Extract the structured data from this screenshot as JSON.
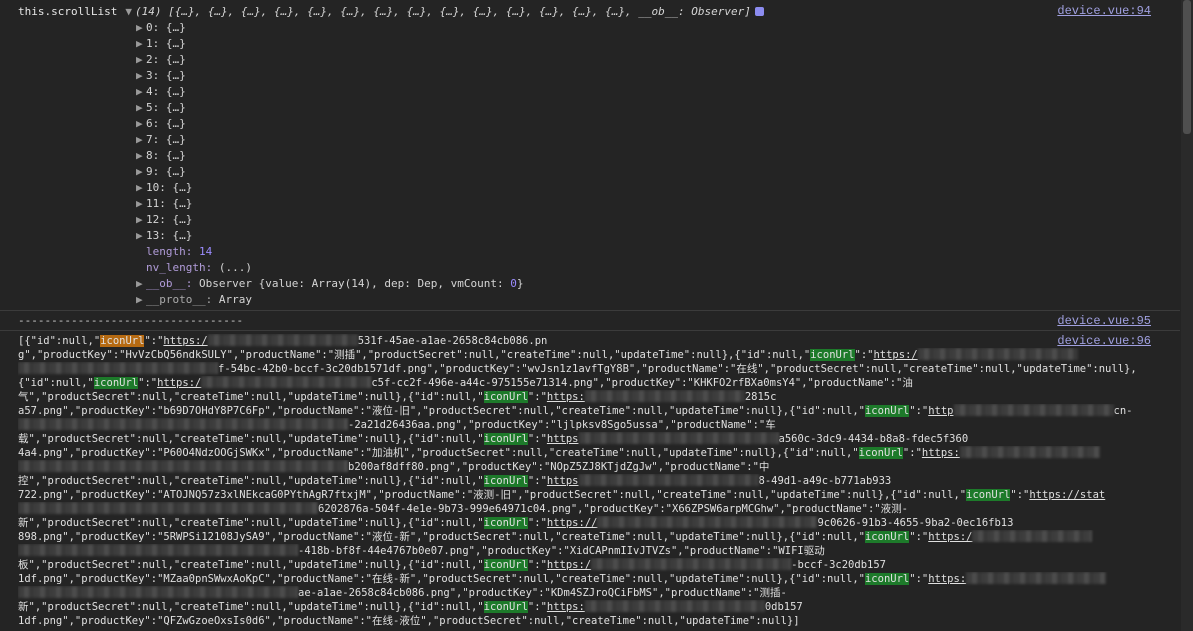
{
  "header": {
    "label": "this.scrollList",
    "triangle": "▼",
    "preview": "(14) [{…}, {…}, {…}, {…}, {…}, {…}, {…}, {…}, {…}, {…}, {…}, {…}, {…}, {…}, __ob__: Observer]",
    "source": "device.vue:94"
  },
  "items": [
    {
      "key": "0:",
      "val": "{…}"
    },
    {
      "key": "1:",
      "val": "{…}"
    },
    {
      "key": "2:",
      "val": "{…}"
    },
    {
      "key": "3:",
      "val": "{…}"
    },
    {
      "key": "4:",
      "val": "{…}"
    },
    {
      "key": "5:",
      "val": "{…}"
    },
    {
      "key": "6:",
      "val": "{…}"
    },
    {
      "key": "7:",
      "val": "{…}"
    },
    {
      "key": "8:",
      "val": "{…}"
    },
    {
      "key": "9:",
      "val": "{…}"
    },
    {
      "key": "10:",
      "val": "{…}"
    },
    {
      "key": "11:",
      "val": "{…}"
    },
    {
      "key": "12:",
      "val": "{…}"
    },
    {
      "key": "13:",
      "val": "{…}"
    }
  ],
  "length": {
    "key": "length:",
    "val": "14"
  },
  "nv_length": {
    "key": "nv_length:",
    "val": "(...)"
  },
  "ob": {
    "key": "__ob__:",
    "val_prefix": "Observer {value: Array(14), dep: Dep, vmCount: ",
    "val_num": "0",
    "val_suffix": "}"
  },
  "proto": {
    "key": "__proto__:",
    "val": "Array"
  },
  "separator": {
    "text": "----------------------------------",
    "source": "device.vue:95"
  },
  "json_source": "device.vue:96",
  "json_lines": [
    [
      [
        "t",
        "[{\"id\":null,\""
      ],
      [
        "o",
        "iconUrl"
      ],
      [
        "t",
        "\":\""
      ],
      [
        "u",
        "https:/"
      ],
      [
        "b",
        ""
      ],
      [
        "t",
        "531f-45ae-a1ae-2658c84cb086.pn"
      ]
    ],
    [
      [
        "t",
        "g\",\"productKey\":\"HvVzCbQ56ndkSULY\",\"productName\":\"测插\",\"productSecret\":null,\"createTime\":null,\"updateTime\":null},{\"id\":null,\""
      ],
      [
        "g",
        "iconUrl"
      ],
      [
        "t",
        "\":\""
      ],
      [
        "u",
        "https:/"
      ],
      [
        "b",
        ""
      ]
    ],
    [
      [
        "b",
        ""
      ],
      [
        "t",
        "f-54bc-42b0-bccf-3c20db1571df.png\",\"productKey\":\"wvJsn1z1avfTgY8B\",\"productName\":\"在线\",\"productSecret\":null,\"createTime\":null,\"updateTime\":null},"
      ]
    ],
    [
      [
        "t",
        "{\"id\":null,\""
      ],
      [
        "g",
        "iconUrl"
      ],
      [
        "t",
        "\":\""
      ],
      [
        "u",
        "https:/"
      ],
      [
        "b",
        ""
      ],
      [
        "t",
        "c5f-cc2f-496e-a44c-975155e71314.png\",\"productKey\":\"KHKFO2rfBXa0msY4\",\"productName\":\"油"
      ]
    ],
    [
      [
        "t",
        "气\",\"productSecret\":null,\"createTime\":null,\"updateTime\":null},{\"id\":null,\""
      ],
      [
        "g",
        "iconUrl"
      ],
      [
        "t",
        "\":\""
      ],
      [
        "u",
        "https:"
      ],
      [
        "b",
        ""
      ],
      [
        "t",
        "2815c"
      ]
    ],
    [
      [
        "t",
        "a57.png\",\"productKey\":\"b69D7OHdY8P7C6Fp\",\"productName\":\"液位-旧\",\"productSecret\":null,\"createTime\":null,\"updateTime\":null},{\"id\":null,\""
      ],
      [
        "g",
        "iconUrl"
      ],
      [
        "t",
        "\":\""
      ],
      [
        "u",
        "http"
      ],
      [
        "b",
        ""
      ],
      [
        "t",
        "cn-"
      ]
    ],
    [
      [
        "b",
        ""
      ],
      [
        "t",
        "-2a21d26436aa.png\",\"productKey\":\"ljlpksv8Sgo5ussa\",\"productName\":\"车"
      ]
    ],
    [
      [
        "t",
        "载\",\"productSecret\":null,\"createTime\":null,\"updateTime\":null},{\"id\":null,\""
      ],
      [
        "g",
        "iconUrl"
      ],
      [
        "t",
        "\":\""
      ],
      [
        "u",
        "https"
      ],
      [
        "b",
        ""
      ],
      [
        "t",
        "a560c-3dc9-4434-b8a8-fdec5f360"
      ]
    ],
    [
      [
        "t",
        "4a4.png\",\"productKey\":\"P60O4NdzOOGjSWKx\",\"productName\":\"加油机\",\"productSecret\":null,\"createTime\":null,\"updateTime\":null},{\"id\":null,\""
      ],
      [
        "g",
        "iconUrl"
      ],
      [
        "t",
        "\":\""
      ],
      [
        "u",
        "https:"
      ],
      [
        "b",
        ""
      ]
    ],
    [
      [
        "b",
        ""
      ],
      [
        "t",
        "b200af8dff80.png\",\"productKey\":\"NOpZ5ZJ8KTjdZgJw\",\"productName\":\"中"
      ]
    ],
    [
      [
        "t",
        "控\",\"productSecret\":null,\"createTime\":null,\"updateTime\":null},{\"id\":null,\""
      ],
      [
        "g",
        "iconUrl"
      ],
      [
        "t",
        "\":\""
      ],
      [
        "u",
        "https"
      ],
      [
        "b",
        ""
      ],
      [
        "t",
        "8-49d1-a49c-b771ab933"
      ]
    ],
    [
      [
        "t",
        "722.png\",\"productKey\":\"ATOJNQ57z3xlNEkcaG0PYthAgR7ftxjM\",\"productName\":\"液测-旧\",\"productSecret\":null,\"createTime\":null,\"updateTime\":null},{\"id\":null,\""
      ],
      [
        "g",
        "iconUrl"
      ],
      [
        "t",
        "\":\""
      ],
      [
        "u",
        "https://stat"
      ]
    ],
    [
      [
        "b",
        ""
      ],
      [
        "t",
        "6202876a-504f-4e1e-9b73-999e64971c04.png\",\"productKey\":\"X66ZPSW6arpMCGhw\",\"productName\":\"液测-"
      ]
    ],
    [
      [
        "t",
        "新\",\"productSecret\":null,\"createTime\":null,\"updateTime\":null},{\"id\":null,\""
      ],
      [
        "g",
        "iconUrl"
      ],
      [
        "t",
        "\":\""
      ],
      [
        "u",
        "https://"
      ],
      [
        "b",
        ""
      ],
      [
        "t",
        "9c0626-91b3-4655-9ba2-0ec16fb13"
      ]
    ],
    [
      [
        "t",
        "898.png\",\"productKey\":\"5RWPSi12108JySA9\",\"productName\":\"液位-新\",\"productSecret\":null,\"createTime\":null,\"updateTime\":null},{\"id\":null,\""
      ],
      [
        "g",
        "iconUrl"
      ],
      [
        "t",
        "\":\""
      ],
      [
        "u",
        "https:/"
      ],
      [
        "b",
        ""
      ]
    ],
    [
      [
        "b",
        ""
      ],
      [
        "t",
        "-418b-bf8f-44e4767b0e07.png\",\"productKey\":\"XidCAPnmIIvJTVZs\",\"productName\":\"WIFI驱动"
      ]
    ],
    [
      [
        "t",
        "板\",\"productSecret\":null,\"createTime\":null,\"updateTime\":null},{\"id\":null,\""
      ],
      [
        "g",
        "iconUrl"
      ],
      [
        "t",
        "\":\""
      ],
      [
        "u",
        "https:/"
      ],
      [
        "b",
        ""
      ],
      [
        "t",
        "-bccf-3c20db157"
      ]
    ],
    [
      [
        "t",
        "1df.png\",\"productKey\":\"MZaa0pnSWwxAoKpC\",\"productName\":\"在线-新\",\"productSecret\":null,\"createTime\":null,\"updateTime\":null},{\"id\":null,\""
      ],
      [
        "g",
        "iconUrl"
      ],
      [
        "t",
        "\":\""
      ],
      [
        "u",
        "https:"
      ],
      [
        "b",
        ""
      ]
    ],
    [
      [
        "b",
        ""
      ],
      [
        "t",
        "ae-a1ae-2658c84cb086.png\",\"productKey\":\"KDm4SZJroQCiFbMS\",\"productName\":\"测插-"
      ]
    ],
    [
      [
        "t",
        "新\",\"productSecret\":null,\"createTime\":null,\"updateTime\":null},{\"id\":null,\""
      ],
      [
        "g",
        "iconUrl"
      ],
      [
        "t",
        "\":\""
      ],
      [
        "u",
        "https:"
      ],
      [
        "b",
        ""
      ],
      [
        "t",
        "0db157"
      ]
    ],
    [
      [
        "t",
        "1df.png\",\"productKey\":\"QFZwGzoeOxsIs0d6\",\"productName\":\"在线-液位\",\"productSecret\":null,\"createTime\":null,\"updateTime\":null}]"
      ]
    ]
  ]
}
